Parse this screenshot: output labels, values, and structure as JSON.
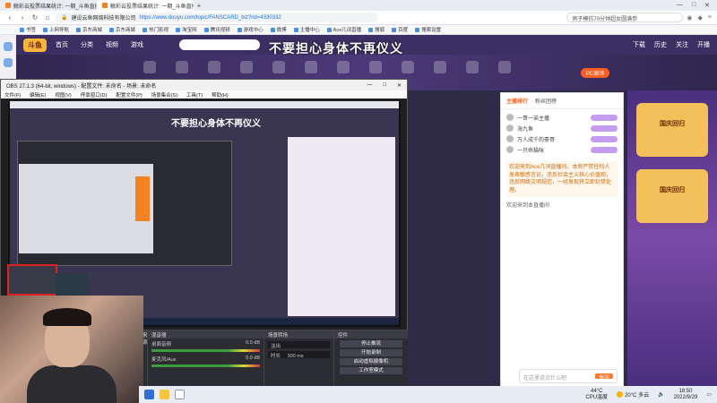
{
  "browser": {
    "tabs": [
      {
        "label": "鲸彩云投票结果统计: 一期_斗鱼直播"
      },
      {
        "label": "鲸彩云投票结果统计: 一期_斗鱼直播"
      }
    ],
    "url_site": "建设云鱼网络科技有限公司",
    "url": "https://www.douyu.com/topic/FANSCARD_biz?rid=4330332",
    "search_text": "男子模仿70分钟超女圆满参",
    "bookmarks": [
      "书签",
      "上网导航",
      "京东商城",
      "京东商城",
      "热门影视",
      "淘宝网",
      "腾讯视频",
      "游戏中心",
      "微博",
      "主播中心",
      "Ace几词直播",
      "搜狐",
      "百度",
      "搜索设置"
    ]
  },
  "site": {
    "logo": "斗鱼",
    "nav": [
      "首页",
      "分类",
      "视频",
      "游戏"
    ],
    "right_nav": [
      "下载",
      "历史",
      "关注",
      "开播"
    ],
    "headline": "不要担心身体不再仪义",
    "pc_badge": "PC剧场"
  },
  "obs": {
    "title": "OBS 27.1.3 (64-bit, windows) - 配置文件: 未命名 - 场景: 未命名",
    "menu": [
      "文件(F)",
      "编辑(E)",
      "视图(V)",
      "停靠窗口(D)",
      "配置文件(P)",
      "场景集合(S)",
      "工具(T)",
      "帮助(H)"
    ],
    "preview_headline": "不要担心身体不再仪义",
    "docks": {
      "sources_title": "来源",
      "mixer_title": "混音器",
      "mixer_rows": [
        {
          "name": "桌面音频",
          "level": "0.0 dB"
        },
        {
          "name": "麦克风/Aux",
          "level": "0.0 dB"
        }
      ],
      "transition_title": "场景转场",
      "transition_value": "淡出",
      "duration_label": "时长",
      "duration_value": "300 ms",
      "controls_title": "控件",
      "controls": [
        "停止推流",
        "开始录制",
        "启动虚拟摄像机",
        "工作室模式",
        "设置"
      ]
    }
  },
  "chat": {
    "tabs": [
      "主播排行",
      "粉丝团榜"
    ],
    "rank": [
      "一哥一弟主播",
      "海九鱼",
      "万人成千的豪哥",
      "一只乖猫咪"
    ],
    "message": "欢迎来到Ace几词直播间。本房严禁任何人发表敏感言论，违反社会主义核心价值观，违反网络文明规范，一经发现将立即封禁处理。",
    "system": "欢迎来到本直播间",
    "input_placeholder": "在这里说点什么吧",
    "send": "发送"
  },
  "event": {
    "promo": "国庆回归"
  },
  "taskbar": {
    "cpu_temp": "44°C",
    "cpu_label": "CPU温度",
    "weather": "20°C 多云",
    "time": "18:50",
    "date": "2022/9/29"
  }
}
